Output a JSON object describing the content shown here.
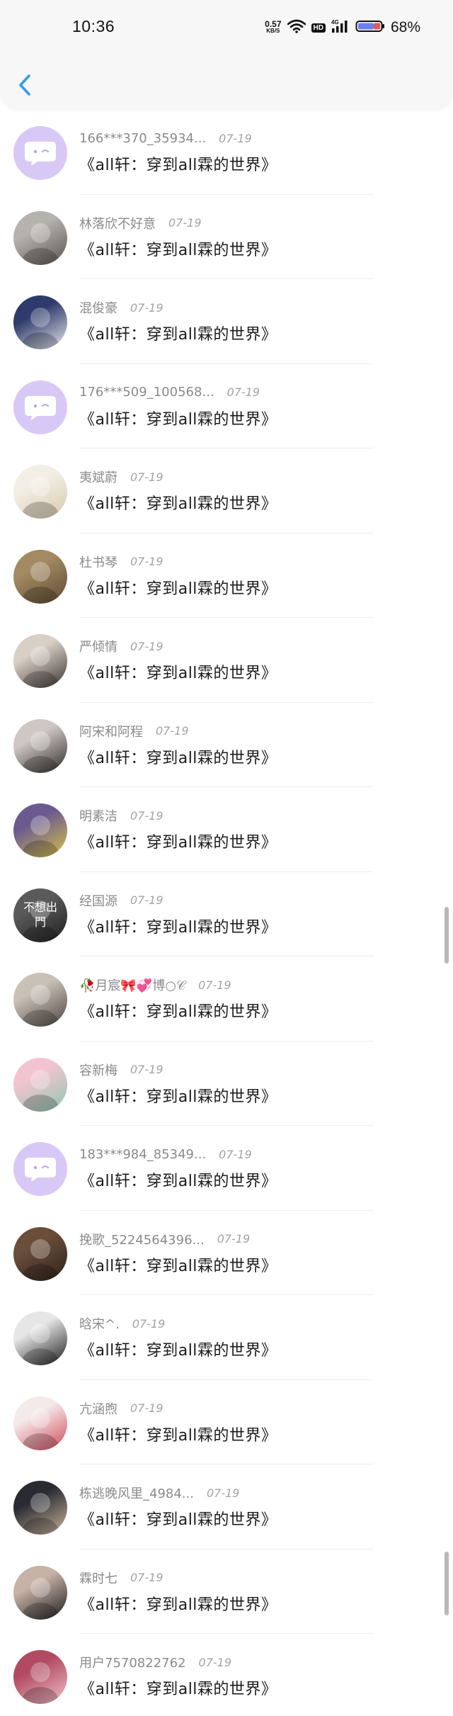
{
  "status_bar": {
    "time": "10:36",
    "net_speed_value": "0.57",
    "net_speed_unit": "KB/S",
    "hd_label": "HD",
    "cell_label": "4G",
    "battery_percent": "68%"
  },
  "colors": {
    "accent": "#2f9ee8",
    "lilac": "#c9b8f0",
    "battery_fill": "#6f7ff0"
  },
  "list": {
    "items": [
      {
        "name": "166***370_35934...",
        "date": "07-19",
        "message": "《all轩：穿到all霖的世界》",
        "avatar": "default-chat-bubble"
      },
      {
        "name": "林落欣不好意",
        "date": "07-19",
        "message": "《all轩：穿到all霖的世界》",
        "avatar": "photo"
      },
      {
        "name": "混俊豪",
        "date": "07-19",
        "message": "《all轩：穿到all霖的世界》",
        "avatar": "photo"
      },
      {
        "name": "176***509_100568...",
        "date": "07-19",
        "message": "《all轩：穿到all霖的世界》",
        "avatar": "default-chat-bubble"
      },
      {
        "name": "夷斌蔚",
        "date": "07-19",
        "message": "《all轩：穿到all霖的世界》",
        "avatar": "photo"
      },
      {
        "name": "杜书琴",
        "date": "07-19",
        "message": "《all轩：穿到all霖的世界》",
        "avatar": "photo"
      },
      {
        "name": "严倾情",
        "date": "07-19",
        "message": "《all轩：穿到all霖的世界》",
        "avatar": "photo"
      },
      {
        "name": "阿宋和阿程",
        "date": "07-19",
        "message": "《all轩：穿到all霖的世界》",
        "avatar": "photo"
      },
      {
        "name": "明素洁",
        "date": "07-19",
        "message": "《all轩：穿到all霖的世界》",
        "avatar": "photo"
      },
      {
        "name": "经国源",
        "date": "07-19",
        "message": "《all轩：穿到all霖的世界》",
        "avatar": "photo",
        "avatar_text": "不想出門"
      },
      {
        "name": "🥀月宸🎀💞博○𝒞",
        "date": "07-19",
        "message": "《all轩：穿到all霖的世界》",
        "avatar": "photo"
      },
      {
        "name": "容新梅",
        "date": "07-19",
        "message": "《all轩：穿到all霖的世界》",
        "avatar": "photo"
      },
      {
        "name": "183***984_85349...",
        "date": "07-19",
        "message": "《all轩：穿到all霖的世界》",
        "avatar": "default-chat-bubble"
      },
      {
        "name": "挽歌_5224564396...",
        "date": "07-19",
        "message": "《all轩：穿到all霖的世界》",
        "avatar": "photo"
      },
      {
        "name": "晗宋^.",
        "date": "07-19",
        "message": "《all轩：穿到all霖的世界》",
        "avatar": "photo"
      },
      {
        "name": "亢涵煦",
        "date": "07-19",
        "message": "《all轩：穿到all霖的世界》",
        "avatar": "photo"
      },
      {
        "name": "栋逃晚风里_4984...",
        "date": "07-19",
        "message": "《all轩：穿到all霖的世界》",
        "avatar": "photo"
      },
      {
        "name": "霖时七",
        "date": "07-19",
        "message": "《all轩：穿到all霖的世界》",
        "avatar": "photo"
      },
      {
        "name": "用户7570822762",
        "date": "07-19",
        "message": "《all轩：穿到all霖的世界》",
        "avatar": "photo"
      }
    ]
  }
}
